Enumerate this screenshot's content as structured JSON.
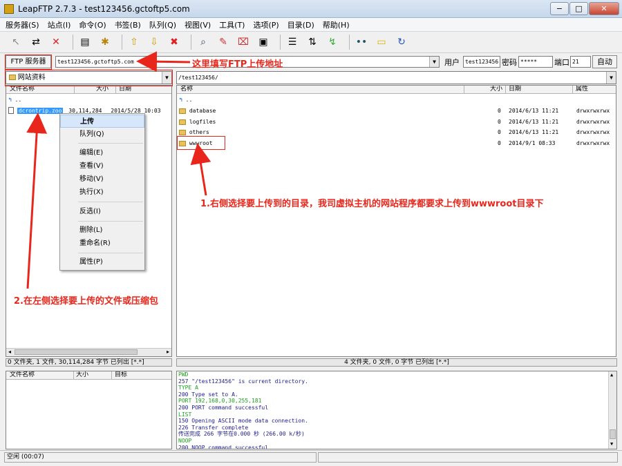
{
  "window": {
    "title": "LeapFTP 2.7.3 - test123456.gctoftp5.com",
    "min": "−",
    "max": "□",
    "close": "✕"
  },
  "menu": [
    "服务器(S)",
    "站点(I)",
    "命令(O)",
    "书签(B)",
    "队列(Q)",
    "视图(V)",
    "工具(T)",
    "选项(P)",
    "目录(D)",
    "帮助(H)"
  ],
  "toolbar_icons": [
    "arrow-icon",
    "disconnect-icon",
    "stop-icon",
    "sep",
    "sitemanager-icon",
    "gear-icon",
    "sep",
    "upload-icon",
    "download-icon",
    "cancel-icon",
    "sep",
    "search-icon",
    "edit-icon",
    "delete-icon",
    "clipboard-icon",
    "sep",
    "list-icon",
    "transfer-icon",
    "sync-icon",
    "sep",
    "dots-icon",
    "folder-icon",
    "refresh-icon"
  ],
  "address": {
    "ftp_button": "FTP 服务器",
    "host": "test123456.gctoftp5.com",
    "user_label": "用户",
    "user": "test123456",
    "pass_label": "密码",
    "pass": "*****",
    "port_label": "端口",
    "port": "21",
    "auto_button": "自动"
  },
  "local": {
    "path": "网站资料",
    "columns": [
      "文件名称",
      "大小",
      "日期"
    ],
    "rows": [
      {
        "name": "..",
        "size": "",
        "date": ""
      },
      {
        "name": "dcrontrip.zoo",
        "size": "30,114,284",
        "date": "2014/5/28 10:03"
      }
    ],
    "status": "0 文件夹, 1 文件, 30,114,284 字节 已列出 [*.*]"
  },
  "remote": {
    "path": "/test123456/",
    "columns": [
      "名称",
      "大小",
      "日期",
      "属性"
    ],
    "rows": [
      {
        "name": "..",
        "size": "",
        "date": "",
        "attr": ""
      },
      {
        "name": "database",
        "size": "0",
        "date": "2014/6/13 11:21",
        "attr": "drwxrwxrwx"
      },
      {
        "name": "logfiles",
        "size": "0",
        "date": "2014/6/13 11:21",
        "attr": "drwxrwxrwx"
      },
      {
        "name": "others",
        "size": "0",
        "date": "2014/6/13 11:21",
        "attr": "drwxrwxrwx"
      },
      {
        "name": "wwwroot",
        "size": "0",
        "date": "2014/9/1 08:33",
        "attr": "drwxrwxrwx"
      }
    ],
    "status": "4 文件夹, 0 文件, 0 字节 已列出 [*.*]"
  },
  "queue": {
    "columns": [
      "文件名称",
      "大小",
      "目标"
    ]
  },
  "log": [
    {
      "text": "PWD",
      "green": true
    },
    {
      "text": "257 \"/test123456\" is current directory.",
      "green": false
    },
    {
      "text": "TYPE A",
      "green": true
    },
    {
      "text": "200 Type set to A.",
      "green": false
    },
    {
      "text": "PORT 192,168,0,30,255,181",
      "green": true
    },
    {
      "text": "200 PORT command successful",
      "green": false
    },
    {
      "text": "LIST",
      "green": true
    },
    {
      "text": "150 Opening ASCII mode data connection.",
      "green": false
    },
    {
      "text": "226 Transfer complete",
      "green": false
    },
    {
      "text": "传送完成 266 字节在0.000 秒 (266.00 k/秒)",
      "green": false
    },
    {
      "text": "NOOP",
      "green": true
    },
    {
      "text": "200 NOOP command successful",
      "green": false
    }
  ],
  "context_menu": [
    "上传",
    "队列(Q)",
    "编辑(E)",
    "查看(V)",
    "移动(V)",
    "执行(X)",
    "反选(I)",
    "删除(L)",
    "重命名(R)",
    "属性(P)"
  ],
  "statusbar": {
    "left": "空闲 (00:07)"
  },
  "annotations": {
    "address_hint": "这里填写FTP上传地址",
    "right_hint": "1.右侧选择要上传到的目录，我司虚拟主机的网站程序都要求上传到wwwroot目录下",
    "left_hint": "2.在左侧选择要上传的文件或压缩包",
    "color": "#e8261b"
  }
}
